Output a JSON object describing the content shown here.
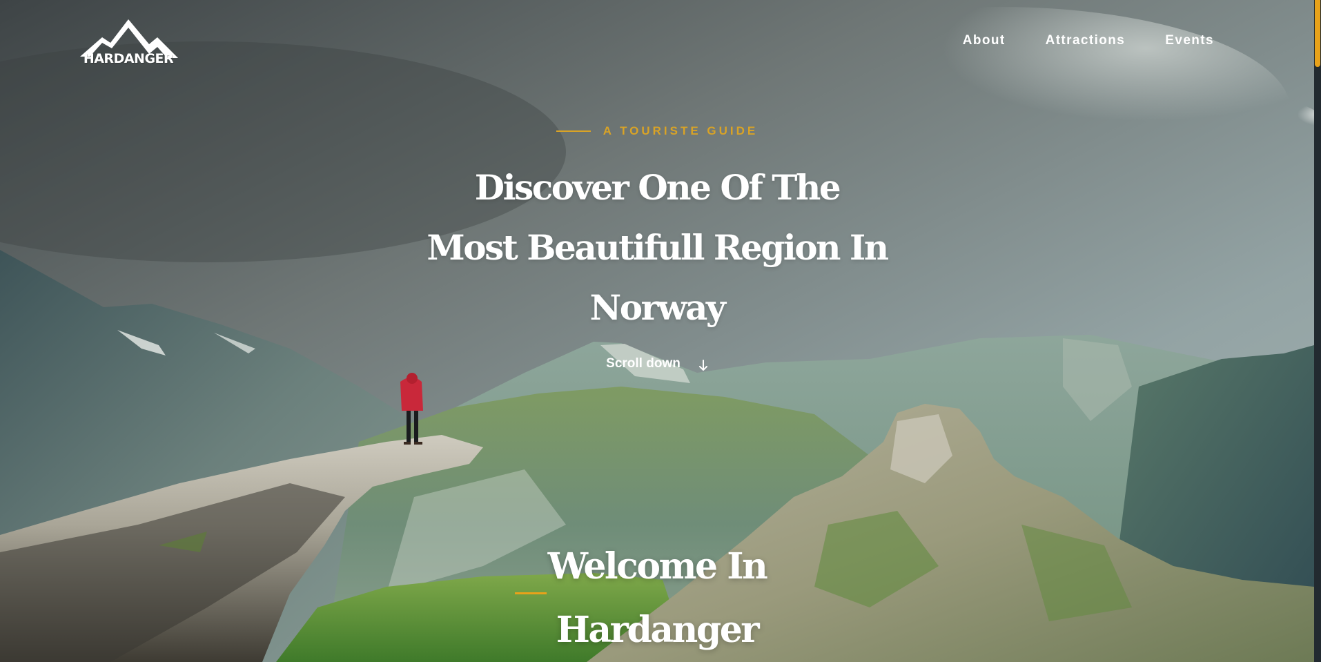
{
  "brand": {
    "logo_text": "HARDANGER"
  },
  "nav": {
    "items": [
      {
        "label": "About"
      },
      {
        "label": "Attractions"
      },
      {
        "label": "Events"
      }
    ]
  },
  "hero": {
    "eyebrow": "A TOURISTE GUIDE",
    "title_lines": [
      "Discover One Of The",
      "Most Beautifull Region In",
      "Norway"
    ],
    "scroll_label": "Scroll down"
  },
  "welcome": {
    "title_lines": [
      "Welcome In",
      "Hardanger"
    ]
  },
  "colors": {
    "accent": "#d9a326",
    "scrollbar_thumb": "#e8a21a",
    "text": "#ffffff"
  },
  "icons": {
    "logo": "mountain-logo-icon",
    "scroll": "arrow-down-icon"
  }
}
